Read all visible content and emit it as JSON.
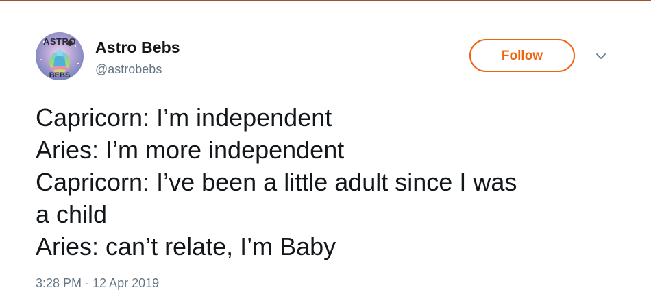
{
  "author": {
    "display_name": "Astro Bebs",
    "handle": "@astrobebs",
    "avatar_icon": "astrology-avatar-icon"
  },
  "follow_button": {
    "label": "Follow",
    "accent_color": "#f0620c"
  },
  "menu": {
    "icon": "chevron-down-icon"
  },
  "tweet": {
    "lines": [
      "Capricorn: I’m independent",
      "Aries: I’m more independent",
      "Capricorn: I’ve been a little adult since I was",
      "a child",
      "Aries: can’t relate, I’m Baby"
    ],
    "timestamp": "3:28 PM - 12 Apr 2019"
  },
  "colors": {
    "text": "#14171a",
    "secondary_text": "#657786"
  }
}
